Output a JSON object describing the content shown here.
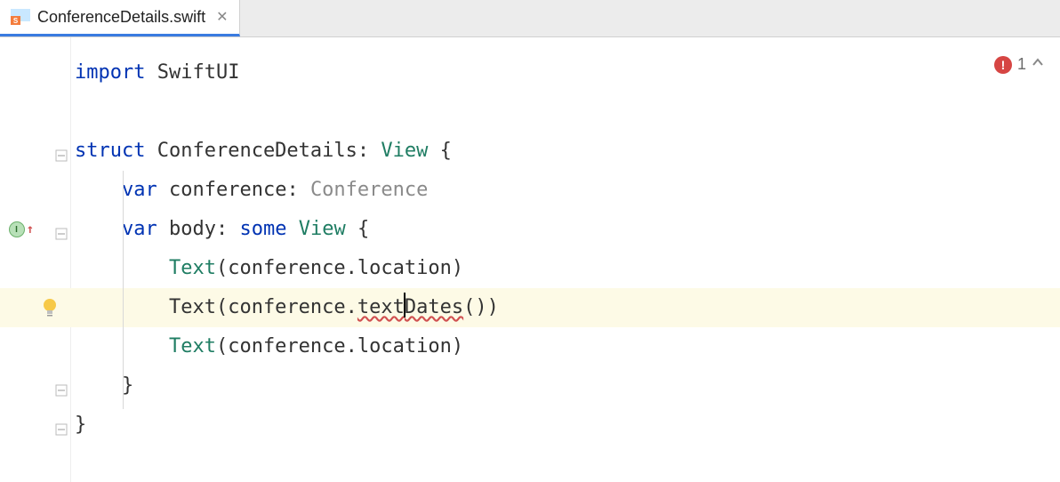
{
  "tab": {
    "filename": "ConferenceDetails.swift"
  },
  "inspection": {
    "error_count": "1"
  },
  "code": {
    "l1": {
      "kw": "import",
      "mod": "SwiftUI"
    },
    "l3": {
      "kw": "struct",
      "name": "ConferenceDetails",
      "proto": "View",
      "open": "{"
    },
    "l4": {
      "kw": "var",
      "name": "conference",
      "colon": ":",
      "type": "Conference"
    },
    "l5": {
      "kw": "var",
      "name": "body",
      "colon": ":",
      "some": "some",
      "type": "View",
      "open": "{"
    },
    "l6": {
      "call": "Text",
      "open": "(",
      "recv": "conference",
      "dot": ".",
      "prop": "location",
      "close": ")"
    },
    "l7": {
      "call": "Text",
      "open": "(",
      "recv": "conference",
      "dot": ".",
      "method_a": "text",
      "method_b": "Dates",
      "parens": "()",
      "close": ")"
    },
    "l8": {
      "call": "Text",
      "open": "(",
      "recv": "conference",
      "dot": ".",
      "prop": "location",
      "close": ")"
    },
    "l9": {
      "close": "}"
    },
    "l10": {
      "close": "}"
    }
  }
}
